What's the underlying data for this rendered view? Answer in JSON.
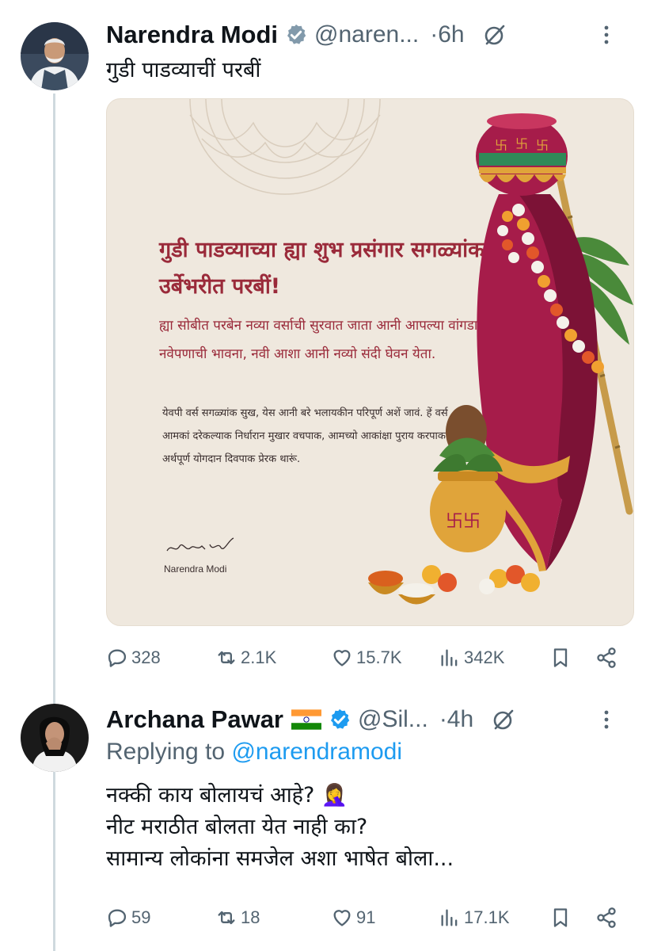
{
  "tweets": [
    {
      "name": "Narendra Modi",
      "handle": "@naren...",
      "time": "·6h",
      "text": "गुडी पाडव्याचीं परबीं",
      "image": {
        "title": "गुडी पाडव्याच्या ह्या शुभ प्रसंगार सगळ्यांक उर्बेभरीत परबीं!",
        "subtitle": "ह्या सोबीत परबेन नव्या वर्साची सुरवात जाता आनी आपल्या वांगडा नवेपणाची भावना, नवी आशा आनी नव्यो संदी घेवन येता.",
        "body": "येवपी वर्स सगळ्यांक सुख, येस आनी बरे भलायकीन परिपूर्ण अशें जावं. हें वर्स आमकां दरेकल्याक निर्धारान मुखार वचपाक, आमच्यो आकांक्षा पुराय करपाक आनी अर्थपूर्ण योगदान दिवपाक प्रेरक थारूं.",
        "signature_name": "Narendra Modi"
      },
      "stats": {
        "replies": "328",
        "reposts": "2.1K",
        "likes": "15.7K",
        "views": "342K"
      }
    },
    {
      "name": "Archana Pawar",
      "handle": "@Sil...",
      "time": "·4h",
      "replying_prefix": "Replying to ",
      "replying_to": "@narendramodi",
      "text_lines": [
        "नक्की काय बोलायचं आहे? 🤦‍♀️",
        "नीट मराठीत बोलता येत नाही का?",
        "सामान्य लोकांना समजेल अशा भाषेत बोला..."
      ],
      "stats": {
        "replies": "59",
        "reposts": "18",
        "likes": "91",
        "views": "17.1K"
      }
    }
  ],
  "icons": [
    "verified-badge-icon",
    "grok-icon",
    "more-icon",
    "reply-icon",
    "repost-icon",
    "like-icon",
    "views-icon",
    "bookmark-icon",
    "share-icon",
    "india-flag-icon"
  ],
  "colors": {
    "accent": "#1d9bf0",
    "muted": "#536471",
    "text": "#0f1419",
    "card_bg": "#efe8de",
    "card_title": "#9a2a3a"
  }
}
